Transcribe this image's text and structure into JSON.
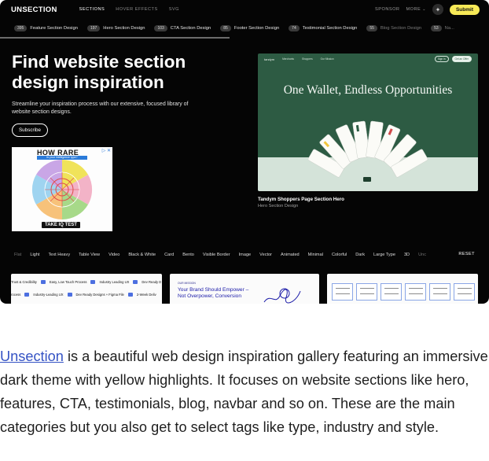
{
  "app": {
    "logo": "UNSECTION"
  },
  "nav": {
    "links": [
      {
        "label": "SECTIONS",
        "active": true
      },
      {
        "label": "HOVER EFFECTS",
        "active": false
      },
      {
        "label": "SVG",
        "active": false
      }
    ],
    "sponsor": "SPONSOR",
    "more": "MORE",
    "submit": "Submit"
  },
  "categories": [
    {
      "count": "395",
      "label": "Feature Section Design"
    },
    {
      "count": "197",
      "label": "Hero Section Design"
    },
    {
      "count": "103",
      "label": "CTA Section Design"
    },
    {
      "count": "85",
      "label": "Footer Section Design"
    },
    {
      "count": "74",
      "label": "Testimonial Section Design"
    },
    {
      "count": "55",
      "label": "Blog Section Design"
    },
    {
      "count": "53",
      "label": "Na..."
    }
  ],
  "hero": {
    "title": "Find website section design inspiration",
    "subtitle": "Streamline your inspiration process with our extensive, focused library of website section designs.",
    "subscribe": "Subscribe"
  },
  "ad": {
    "title": "HOW RARE",
    "band": "is your intelligence type?",
    "cta": "TAKE IQ TEST",
    "close": "▷ ✕"
  },
  "featured": {
    "logo": "tandym",
    "links": [
      "Merchants",
      "Shoppers",
      "Our Mission"
    ],
    "sign_in": "Sign in",
    "get_app": "Get an Offer",
    "headline": "One Wallet, Endless Opportunities",
    "caption": "Tandym Shoppers Page Section Hero",
    "meta": "Hero Section Design"
  },
  "tags": [
    "Flat",
    "Light",
    "Text Heavy",
    "Table View",
    "Video",
    "Black & White",
    "Card",
    "Bento",
    "Visible Border",
    "Image",
    "Vector",
    "Animated",
    "Minimal",
    "Colorful",
    "Dark",
    "Large Type",
    "3D",
    "Unc"
  ],
  "reset": "RESET",
  "thumbs": {
    "t1_row1": [
      "Trust & Credibility",
      "Easy, Low Touch Process",
      "Industry Leading UX",
      "Dev Ready D"
    ],
    "t1_row2": [
      "rocess",
      "Industry-Leading UX",
      "Dev Ready Designs + Figma File",
      "2-Week Deliv"
    ],
    "t2_tag": "OUR MISSION",
    "t2_head": "Your Brand Should Empower – Not Overpower, Conversion"
  },
  "caption": {
    "link": "Unsection",
    "text": " is a beautiful web design inspiration gallery featuring an immersive dark theme with yellow highlights. It focuses on website sections like hero, features, CTA, testimonials, blog, navbar and so on. These are the main categories but you also get to select tags like type, industry and style."
  }
}
